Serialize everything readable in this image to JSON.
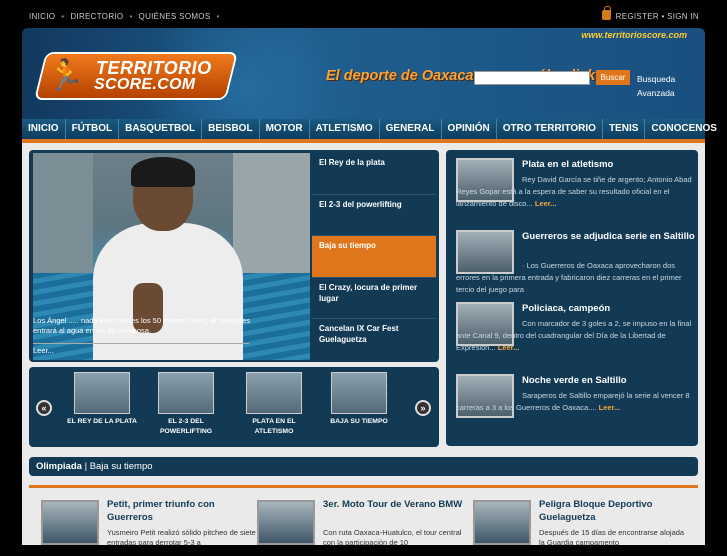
{
  "topnav": {
    "items": [
      "INICIO",
      "DIRECTORIO",
      "QUIÉNES SOMOS"
    ],
    "login": "REGISTER • SIGN IN"
  },
  "header": {
    "url": "www.territorioscore.com",
    "logo_line1": "TERRITORIO",
    "logo_line2": "SCORE.COM",
    "slogan": "El deporte de Oaxaca con un sólo click",
    "search_button": "Buscar",
    "search_advanced": "Busqueda Avanzada"
  },
  "nav": [
    "INICIO",
    "FÚTBOL",
    "BASQUETBOL",
    "BEISBOL",
    "MOTOR",
    "ATLETISMO",
    "GENERAL",
    "OPINIÓN",
    "OTRO TERRITORIO",
    "TENIS",
    "CONOCENOS"
  ],
  "feature": {
    "caption": "Los Ángel ..... nada este martes los 50 metros libres, el miércoles entrará al agua en los 50 mariposa.",
    "more": "Leer...",
    "list": [
      "El Rey de la plata",
      "El 2-3 del powerlifting",
      "Baja su tiempo",
      "El Crazy, locura de primer lugar",
      "Cancelan IX Car Fest Guelaguetza"
    ]
  },
  "carousel": [
    "EL REY DE LA PLATA",
    "EL 2-3 DEL POWERLIFTING",
    "PLATA EN EL ATLETISMO",
    "BAJA SU TIEMPO"
  ],
  "sidebar": [
    {
      "title": "Plata en el atletismo",
      "text": "Rey David García se tiñe de argento; Antonio Abad Reyes Gopar está a la espera de saber su resultado oficial en el lanzamiento de disco...",
      "more": "Leer..."
    },
    {
      "title": "Guerreros se adjudica serie en Saltillo",
      "text": "· Los Guerreros de Oaxaca aprovecharon dos errores en la primera entrada y fabricaron diez carreras en el primer tercio del juego para",
      "more": ""
    },
    {
      "title": "Policiaca, campeón",
      "text": "Con marcador de 3 goles a 2, se impuso en la final ante Canal 9, dentro del cuadrangular del Día de la Libertad de Expresión...",
      "more": "Leer..."
    },
    {
      "title": "Noche verde en Saltillo",
      "text": "Saraperos de Saltillo emparejó la serie al vencer 8 carreras a 3 a los Guerreros de Oaxaca....",
      "more": "Leer..."
    }
  ],
  "section": {
    "name": "Olimpiada",
    "sub": "Baja su tiempo"
  },
  "bottom": [
    {
      "title": "Petit, primer triunfo con Guerreros",
      "text": "Yusmeiro Petit realizó sólido pitcheo de siete entradas para derrotar 5-3 a"
    },
    {
      "title": "3er. Moto Tour de Verano BMW",
      "text": "Con ruta Oaxaca-Huatulco, el tour central con la participación de 10"
    },
    {
      "title": "Peligra Bloque Deportivo Guelaguetza",
      "text": "Después de 15 días de encontrarse alojada la Guardia campamento"
    }
  ]
}
